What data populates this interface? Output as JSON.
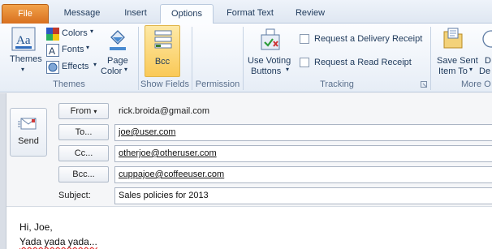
{
  "tabs": [
    {
      "label": "File"
    },
    {
      "label": "Message"
    },
    {
      "label": "Insert"
    },
    {
      "label": "Options"
    },
    {
      "label": "Format Text"
    },
    {
      "label": "Review"
    }
  ],
  "ribbon": {
    "themes": {
      "themes_label": "Themes",
      "colors_label": "Colors",
      "fonts_label": "Fonts",
      "effects_label": "Effects",
      "page_color_label1": "Page",
      "page_color_label2": "Color",
      "group_label": "Themes"
    },
    "show_fields": {
      "bcc_label": "Bcc",
      "group_label": "Show Fields"
    },
    "permission": {
      "group_label": "Permission"
    },
    "tracking": {
      "use_voting_label1": "Use Voting",
      "use_voting_label2": "Buttons",
      "delivery_receipt_label": "Request a Delivery Receipt",
      "read_receipt_label": "Request a Read Receipt",
      "group_label": "Tracking"
    },
    "more": {
      "save_sent_label1": "Save Sent",
      "save_sent_label2": "Item To",
      "delay_label1": "D",
      "delay_label2": "De",
      "group_label": "More O"
    }
  },
  "compose": {
    "send_label": "Send",
    "from_label": "From",
    "from_value": "rick.broida@gmail.com",
    "to_label": "To...",
    "to_value": "joe@user.com",
    "cc_label": "Cc...",
    "cc_value": "otherjoe@otheruser.com",
    "bcc_label": "Bcc...",
    "bcc_value": "cuppajoe@coffeeuser.com",
    "subject_label": "Subject:",
    "subject_value": "Sales policies for 2013",
    "body_line1": "Hi, Joe,",
    "body_line2": "Yada yada yada..."
  },
  "colors": {
    "file_tab": "#d8701f",
    "bcc_highlight": "#fac957",
    "ribbon_text": "#1e395b",
    "misspelling": "#e03030"
  }
}
